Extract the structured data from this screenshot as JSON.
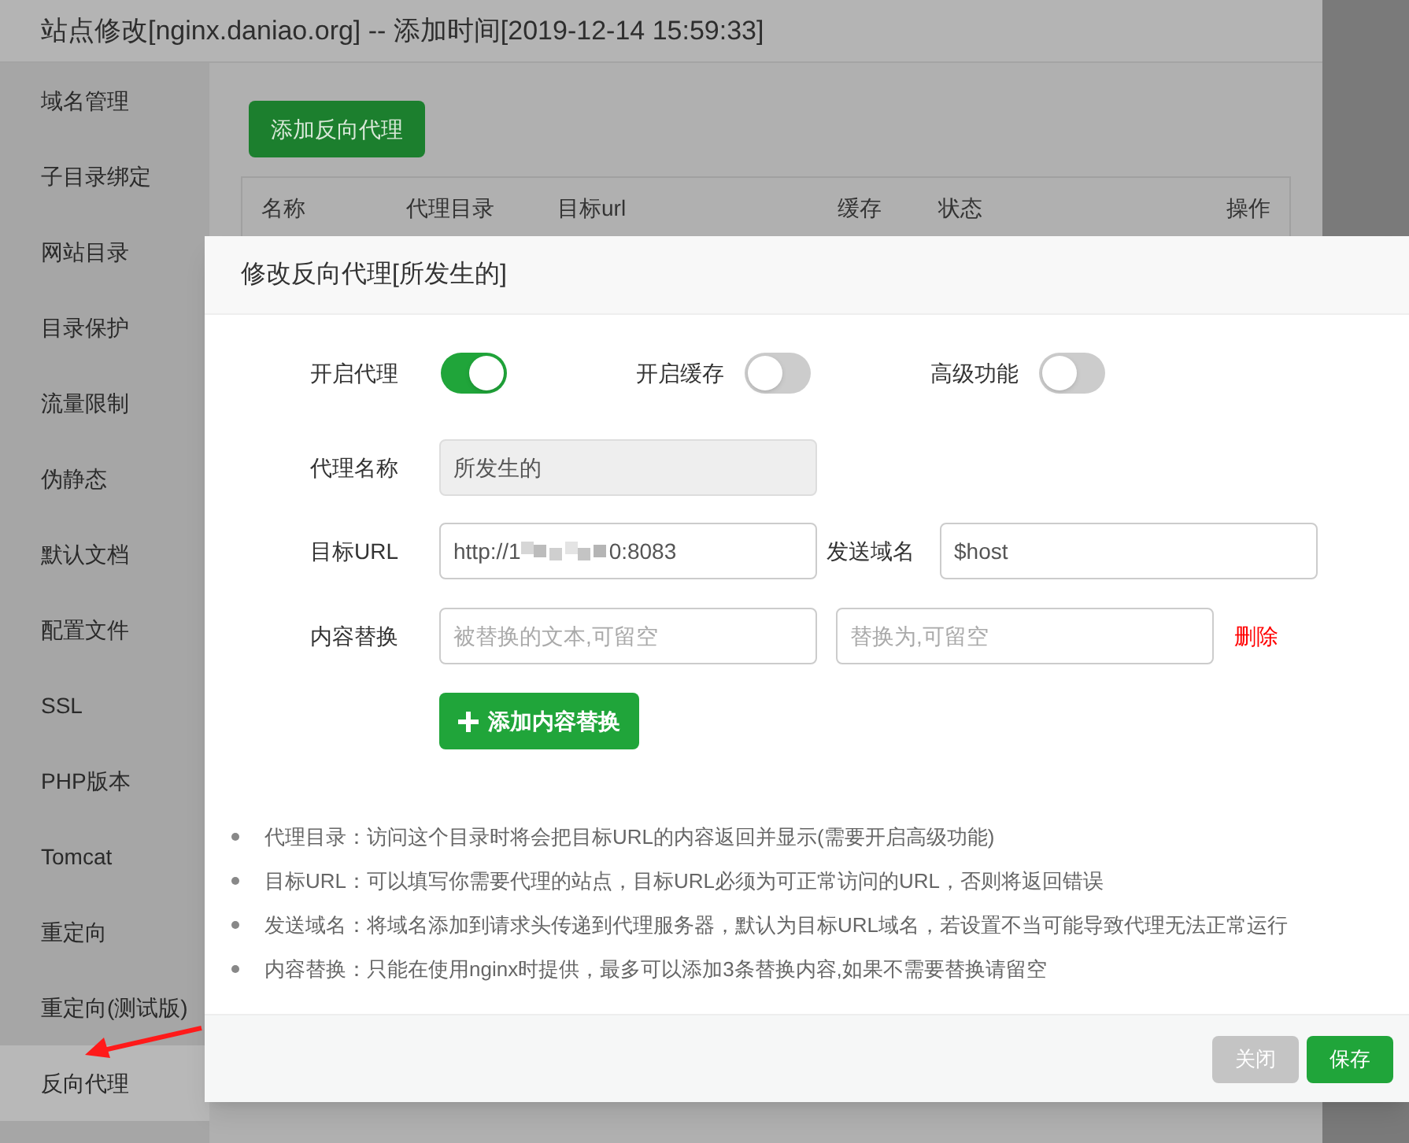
{
  "background_window": {
    "title": "站点修改[nginx.daniao.org] -- 添加时间[2019-12-14 15:59:33]"
  },
  "sidebar": {
    "items": [
      {
        "label": "域名管理",
        "selected": false
      },
      {
        "label": "子目录绑定",
        "selected": false
      },
      {
        "label": "网站目录",
        "selected": false
      },
      {
        "label": "目录保护",
        "selected": false
      },
      {
        "label": "流量限制",
        "selected": false
      },
      {
        "label": "伪静态",
        "selected": false
      },
      {
        "label": "默认文档",
        "selected": false
      },
      {
        "label": "配置文件",
        "selected": false
      },
      {
        "label": "SSL",
        "selected": false
      },
      {
        "label": "PHP版本",
        "selected": false
      },
      {
        "label": "Tomcat",
        "selected": false
      },
      {
        "label": "重定向",
        "selected": false
      },
      {
        "label": "重定向(测试版)",
        "selected": false
      },
      {
        "label": "反向代理",
        "selected": true
      }
    ]
  },
  "add_button": "添加反向代理",
  "table": {
    "columns": [
      "名称",
      "代理目录",
      "目标url",
      "缓存",
      "状态",
      "操作"
    ]
  },
  "dialog": {
    "title": "修改反向代理[所发生的]",
    "toggles": [
      {
        "label": "开启代理",
        "on": true
      },
      {
        "label": "开启缓存",
        "on": false
      },
      {
        "label": "高级功能",
        "on": false
      }
    ],
    "name_label": "代理名称",
    "name_value": "所发生的",
    "url_label": "目标URL",
    "url_prefix": "http://1",
    "url_suffix": "0:8083",
    "host_label": "发送域名",
    "host_value": "$host",
    "replace_label": "内容替换",
    "replace_from_placeholder": "被替换的文本,可留空",
    "replace_to_placeholder": "替换为,可留空",
    "delete_link": "删除",
    "add_replace_button": "添加内容替换",
    "notes": [
      "代理目录：访问这个目录时将会把目标URL的内容返回并显示(需要开启高级功能)",
      "目标URL：可以填写你需要代理的站点，目标URL必须为可正常访问的URL，否则将返回错误",
      "发送域名：将域名添加到请求头传递到代理服务器，默认为目标URL域名，若设置不当可能导致代理无法正常运行",
      "内容替换：只能在使用nginx时提供，最多可以添加3条替换内容,如果不需要替换请留空"
    ],
    "buttons": [
      {
        "label": "关闭",
        "kind": "secondary"
      },
      {
        "label": "保存",
        "kind": "primary"
      }
    ]
  }
}
